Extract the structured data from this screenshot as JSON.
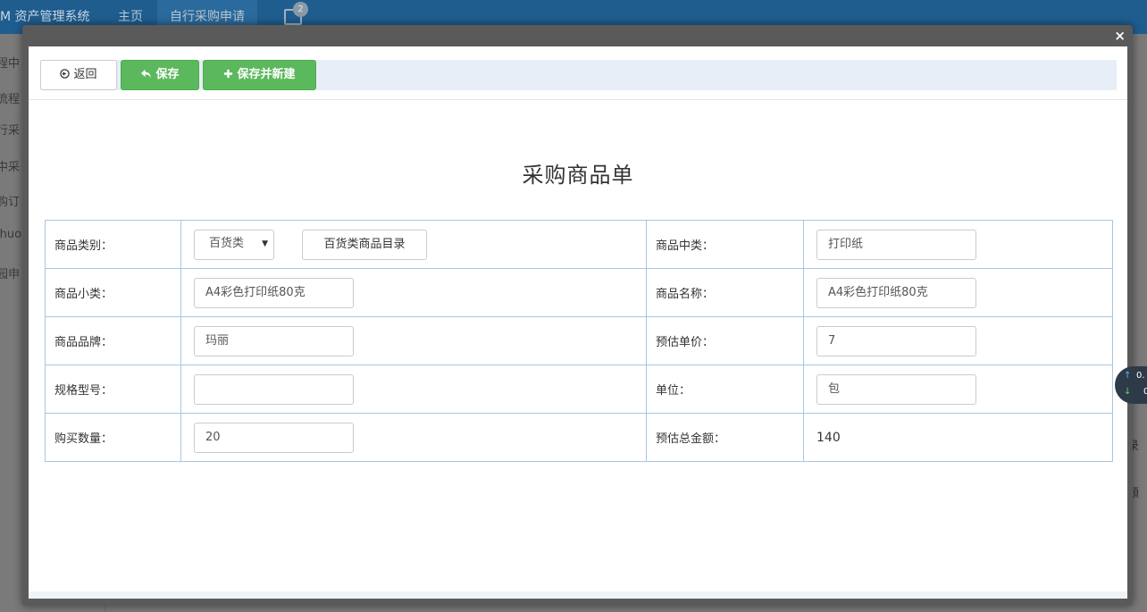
{
  "app": {
    "title": "M 资产管理系统",
    "nav": [
      "主页",
      "自行采购申请"
    ],
    "tab_badge": "2"
  },
  "sidebar": {
    "items": [
      "程中",
      "流程",
      "行采",
      "中采",
      "购订",
      "ihuo",
      "园申"
    ]
  },
  "background_right": {
    "frag1": "录",
    "frag2": "額"
  },
  "speed_widget": {
    "up": "0.",
    "down": "0"
  },
  "modal": {
    "close_symbol": "×",
    "toolbar": {
      "back_label": "返回",
      "save_label": "保存",
      "save_new_label": "保存并新建"
    },
    "form_title": "采购商品单",
    "fields": {
      "category": {
        "label": "商品类别：",
        "selected": "百货类",
        "catalog_button": "百货类商品目录"
      },
      "mid_category": {
        "label": "商品中类：",
        "value": "打印纸"
      },
      "sub_category": {
        "label": "商品小类：",
        "value": "A4彩色打印纸80克"
      },
      "name": {
        "label": "商品名称：",
        "value": "A4彩色打印纸80克"
      },
      "brand": {
        "label": "商品品牌：",
        "value": "玛丽"
      },
      "unit_price": {
        "label": "预估单价：",
        "value": "7"
      },
      "spec": {
        "label": "规格型号：",
        "value": ""
      },
      "unit": {
        "label": "单位：",
        "value": "包"
      },
      "quantity": {
        "label": "购买数量：",
        "value": "20"
      },
      "total": {
        "label": "预估总金额：",
        "value": "140"
      }
    }
  }
}
